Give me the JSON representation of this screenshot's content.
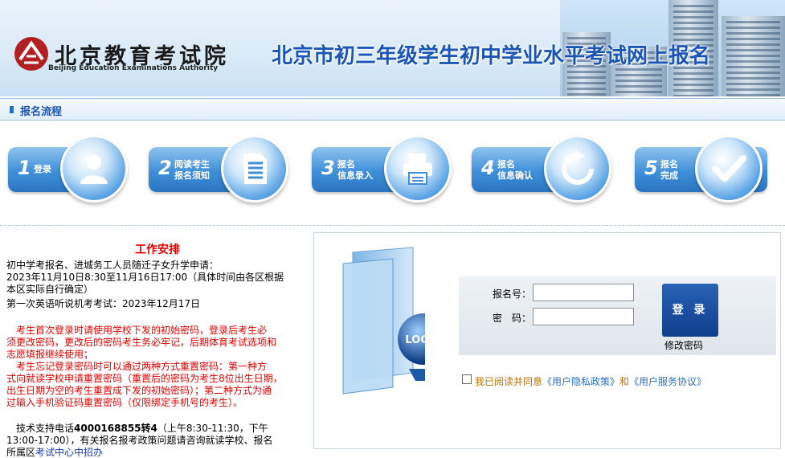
{
  "header": {
    "logo_cn": "北京教育考试院",
    "logo_en": "Beijing Education Examinations Authority",
    "site_title": "北京市初三年级学生初中学业水平考试网上报名"
  },
  "section": {
    "title": "报名流程"
  },
  "steps": [
    {
      "num": "1",
      "label_line1": "登录",
      "label_line2": "",
      "icon": "user-icon"
    },
    {
      "num": "2",
      "label_line1": "阅读考生",
      "label_line2": "报名须知",
      "icon": "document-icon"
    },
    {
      "num": "3",
      "label_line1": "报名",
      "label_line2": "信息录入",
      "icon": "printer-icon"
    },
    {
      "num": "4",
      "label_line1": "报名",
      "label_line2": "信息确认",
      "icon": "refresh-icon"
    },
    {
      "num": "5",
      "label_line1": "报名",
      "label_line2": "完成",
      "icon": "checkmark-icon"
    }
  ],
  "schedule": {
    "title": "工作安排",
    "line1": "初中学考报名、进城务工人员随迁子女升学申请：",
    "line2": "2023年11月10日8:30至11月16日17:00（具体时间由各区根据",
    "line3": "本区实际自行确定）",
    "line4": "第一次英语听说机考考试：2023年12月17日",
    "notice1_l1": "考生首次登录时请使用学校下发的初始密码，登录后考生必",
    "notice1_l2": "须更改密码，更改后的密码考生务必牢记，后期体育考试选项和",
    "notice1_l3": "志愿填报继续使用；",
    "notice2_l1": "考生忘记登录密码时可以通过两种方式重置密码：第一种方",
    "notice2_l2": "式向就读学校申请重置密码（重置后的密码为考生8位出生日期，",
    "notice2_l3": "出生日期为空的考生重置成下发的初始密码）；第二种方式为通",
    "notice2_l4": "过输入手机验证码重置密码（仅限绑定手机号的考生）。",
    "support_prefix": "技术支持电话",
    "support_phone": "4000168855转4",
    "support_hours": "（上午8:30-11:30，下午",
    "support_l2": "13:00-17:00），有关报名报考政策问题请咨询就读学校、报名",
    "support_l3_a": "所属区",
    "support_l3_link": "考试中心中招办"
  },
  "login": {
    "folder_text": "LOGIN",
    "username_label": "报名号：",
    "password_label": "密　码：",
    "username_value": "",
    "password_value": "",
    "login_button": "登 录",
    "modify_password": "修改密码",
    "agree_prefix": "我已阅读并同意",
    "privacy_link": "《用户隐私政策》",
    "agree_and": "和",
    "service_link": "《用户服务协议》"
  }
}
